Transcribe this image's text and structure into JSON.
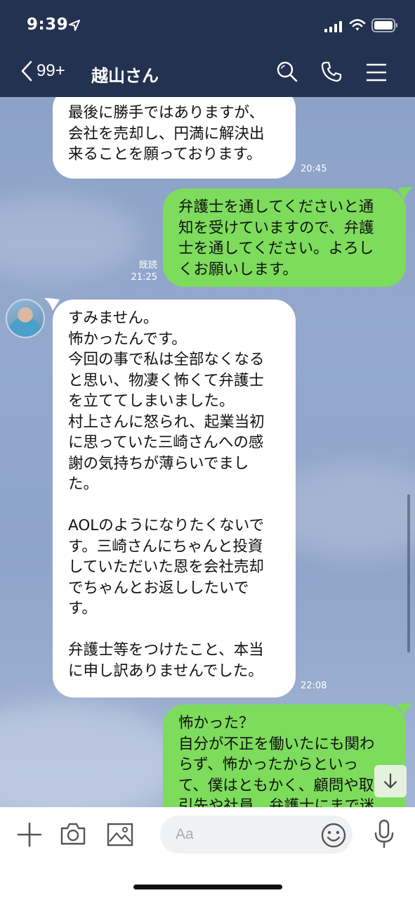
{
  "status_bar": {
    "time": "9:39"
  },
  "header": {
    "back_count": "99+",
    "title": "越山さん"
  },
  "messages": [
    {
      "side": "in",
      "lines": [
        "最後に勝手ではありますが、",
        "会社を売却し、円満に解決出",
        "来ることを願っております。"
      ],
      "time": "20:45"
    },
    {
      "side": "out",
      "read": "既読",
      "time": "21:25",
      "lines": [
        "弁護士を通してくださいと通",
        "知を受けていますので、弁護",
        "士を通してください。よろし",
        "くお願いします。"
      ]
    },
    {
      "side": "in",
      "time": "22:08",
      "lines": [
        "すみません。",
        "怖かったんです。",
        "今回の事で私は全部なくなる",
        "と思い、物凄く怖くて弁護士",
        "を立ててしまいました。",
        "村上さんに怒られ、起業当初",
        "に思っていた三崎さんへの感",
        "謝の気持ちが薄らいでまし",
        "た。",
        "",
        "AOLのようになりたくないで",
        "す。三崎さんにちゃんと投資",
        "していただいた恩を会社売却",
        "でちゃんとお返ししたいで",
        "す。",
        "",
        "弁護士等をつけたこと、本当",
        "に申し訳ありませんでした。"
      ]
    },
    {
      "side": "out",
      "lines": [
        "怖かった？",
        "自分が不正を働いたにも関わ",
        "らず、怖かったからといっ",
        "て、僕はともかく、顧問や取",
        "引先や社員、弁護士にまで迷"
      ]
    }
  ],
  "input": {
    "placeholder": "Aa"
  },
  "icons": {
    "header": [
      "chevron-left-icon",
      "search-icon",
      "phone-icon",
      "menu-icon"
    ],
    "bottom": [
      "plus-icon",
      "camera-icon",
      "image-icon",
      "emoji-icon",
      "microphone-icon"
    ],
    "chat": [
      "arrow-down-icon"
    ]
  },
  "colors": {
    "header_bg": "#243252",
    "outgoing_bubble": "#7ddc5b",
    "incoming_bubble": "#ffffff"
  }
}
